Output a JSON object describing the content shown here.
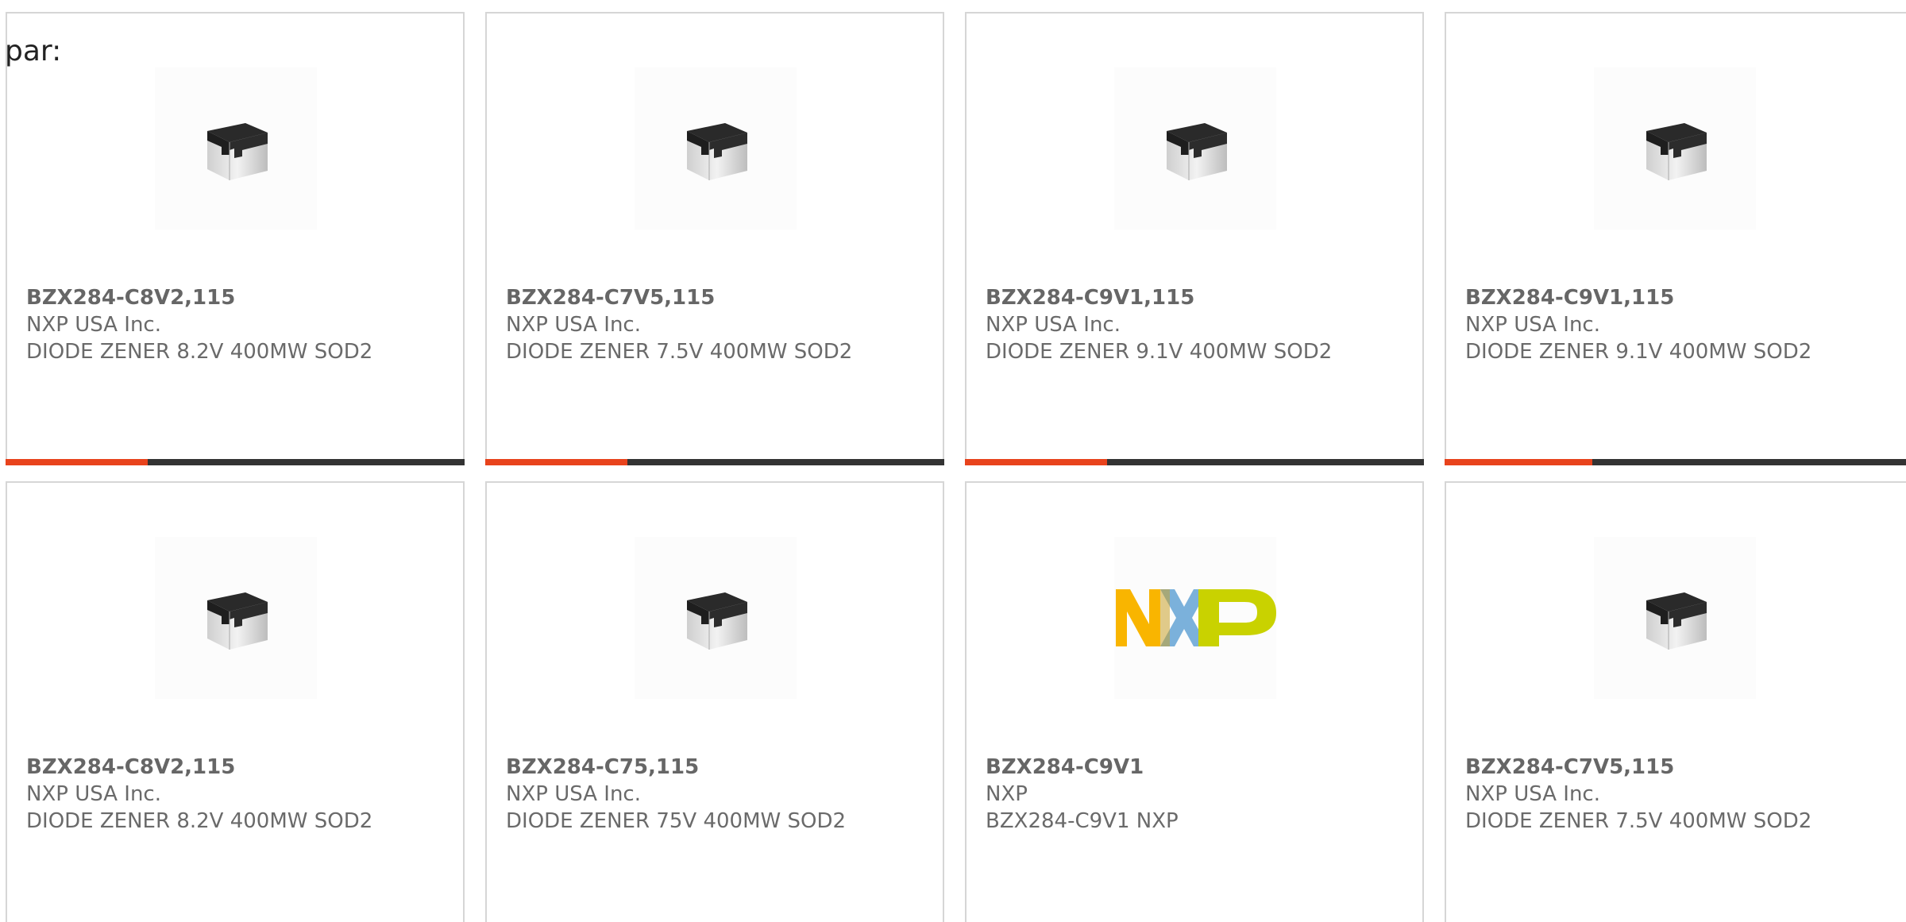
{
  "intro": "par:",
  "accent_color": "#e8431c",
  "bar_color": "#333333",
  "cards": [
    {
      "part_number": "BZX284-C8V2,115",
      "manufacturer": "NXP USA Inc.",
      "description": "DIODE ZENER 8.2V 400MW SOD2",
      "image": "diode-chip-icon",
      "progress_fraction": 0.31
    },
    {
      "part_number": "BZX284-C7V5,115",
      "manufacturer": "NXP USA Inc.",
      "description": "DIODE ZENER 7.5V 400MW SOD2",
      "image": "diode-chip-icon",
      "progress_fraction": 0.31
    },
    {
      "part_number": "BZX284-C9V1,115",
      "manufacturer": "NXP USA Inc.",
      "description": "DIODE ZENER 9.1V 400MW SOD2",
      "image": "diode-chip-icon",
      "progress_fraction": 0.31
    },
    {
      "part_number": "BZX284-C9V1,115",
      "manufacturer": "NXP USA Inc.",
      "description": "DIODE ZENER 9.1V 400MW SOD2",
      "image": "diode-chip-icon",
      "progress_fraction": 0.31
    },
    {
      "part_number": "BZX284-C8V2,115",
      "manufacturer": "NXP USA Inc.",
      "description": "DIODE ZENER 8.2V 400MW SOD2",
      "image": "diode-chip-icon"
    },
    {
      "part_number": "BZX284-C75,115",
      "manufacturer": "NXP USA Inc.",
      "description": "DIODE ZENER 75V 400MW SOD2",
      "image": "diode-chip-icon"
    },
    {
      "part_number": "BZX284-C9V1",
      "manufacturer": "NXP",
      "description": "BZX284-C9V1 NXP",
      "image": "nxp-logo",
      "logo_text": "NXP"
    },
    {
      "part_number": "BZX284-C7V5,115",
      "manufacturer": "NXP USA Inc.",
      "description": "DIODE ZENER 7.5V 400MW SOD2",
      "image": "diode-chip-icon"
    }
  ]
}
